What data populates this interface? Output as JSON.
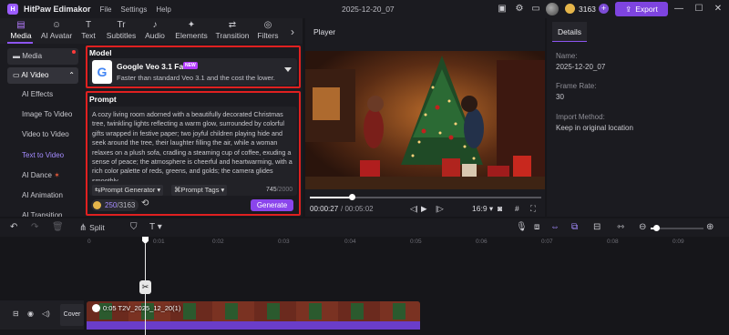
{
  "app": {
    "name": "HitPaw Edimakor",
    "menu": [
      "File",
      "Settings",
      "Help"
    ],
    "project_name": "2025-12-20_07",
    "coins": "3163",
    "export_label": "Export"
  },
  "tabs": [
    {
      "label": "Media",
      "icon": "media-icon",
      "active": true
    },
    {
      "label": "AI Avatar",
      "icon": "ai-avatar-icon"
    },
    {
      "label": "Text",
      "icon": "text-icon"
    },
    {
      "label": "Subtitles",
      "icon": "subtitles-icon"
    },
    {
      "label": "Audio",
      "icon": "audio-icon"
    },
    {
      "label": "Elements",
      "icon": "elements-icon"
    },
    {
      "label": "Transition",
      "icon": "transition-icon"
    },
    {
      "label": "Filters",
      "icon": "filters-icon"
    }
  ],
  "sidebar": {
    "media": "Media",
    "ai_video": "AI Video",
    "items": [
      "AI Effects",
      "Image To Video",
      "Video to Video",
      "Text to Video",
      "AI Dance",
      "AI Animation",
      "AI Transition"
    ],
    "active_item": "Text to Video"
  },
  "model": {
    "section_title": "Model",
    "name": "Google Veo 3.1 Fast",
    "badge": "NEW",
    "description": "Faster than standard Veo 3.1 and the cost the lower."
  },
  "prompt": {
    "section_title": "Prompt",
    "text": "A cozy living room adorned with a beautifully decorated Christmas tree, twinkling lights reflecting a warm glow, surrounded by colorful gifts wrapped in festive paper; two joyful children playing hide and seek around the tree, their laughter filling the air, while a woman relaxes on a plush sofa, cradling a steaming cup of coffee, exuding a sense of peace; the atmosphere is cheerful and heartwarming, with a rich color palette of reds, greens, and golds; the camera glides smoothly",
    "generator_label": "Prompt Generator",
    "tags_label": "Prompt Tags",
    "char_count": "745",
    "char_limit": "/2000",
    "credits_used": "250",
    "credits_total": "/3163",
    "generate_label": "Generate"
  },
  "player": {
    "title": "Player",
    "current_time": "00:00:27",
    "total_time": "/ 00:05:02",
    "aspect": "16:9",
    "progress": 0.18
  },
  "details": {
    "tab_label": "Details",
    "fields": [
      {
        "label": "Name:",
        "value": "2025-12-20_07"
      },
      {
        "label": "Frame Rate:",
        "value": "30"
      },
      {
        "label": "Import Method:",
        "value": "Keep in original location"
      }
    ]
  },
  "timeline": {
    "split_label": "Split",
    "ticks": [
      "0",
      "0:01",
      "0:02",
      "0:03",
      "0:04",
      "0:05",
      "0:06",
      "0:07",
      "0:08",
      "0:09"
    ],
    "cover_label": "Cover",
    "clip_label": "0:05 T2V_2025_12_20(1)",
    "zoom": 0.1
  }
}
